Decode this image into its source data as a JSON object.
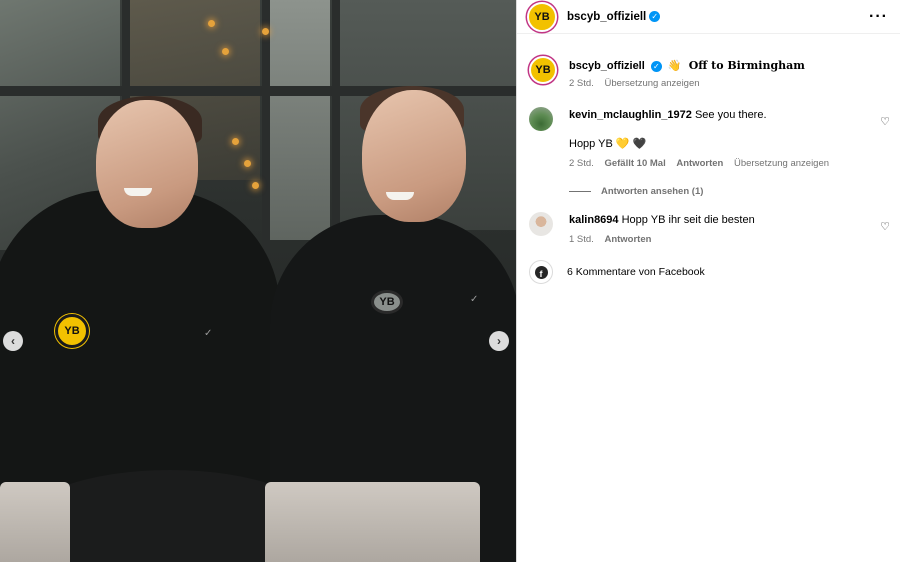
{
  "post": {
    "header": {
      "username": "bscyb_offiziell",
      "verified": true,
      "avatar_text": "YB",
      "more_icon": "more-dots-icon"
    },
    "caption": {
      "username": "bscyb_offiziell",
      "emoji": "👋",
      "text": "Off to Birmingham",
      "time": "2 Std.",
      "translate_label": "Übersetzung anzeigen"
    },
    "comments": [
      {
        "username": "kevin_mclaughlin_1972",
        "text_line1": "See you there.",
        "text_line2": "Hopp YB 💛 🖤",
        "time": "2 Std.",
        "likes": "Gefällt 10 Mal",
        "reply_label": "Antworten",
        "translate_label": "Übersetzung anzeigen",
        "view_replies": "Antworten ansehen (1)"
      },
      {
        "username": "kalin8694",
        "text": "Hopp YB ihr seit die besten",
        "time": "1 Std.",
        "reply_label": "Antworten"
      }
    ],
    "facebook_comments": "6 Kommentare von Facebook"
  },
  "media": {
    "prev_icon": "chevron-left-icon",
    "next_icon": "chevron-right-icon",
    "crest_text": "YB"
  },
  "colors": {
    "verified_blue": "#0095f6",
    "yb_yellow": "#f2c100",
    "muted_text": "#737373"
  }
}
